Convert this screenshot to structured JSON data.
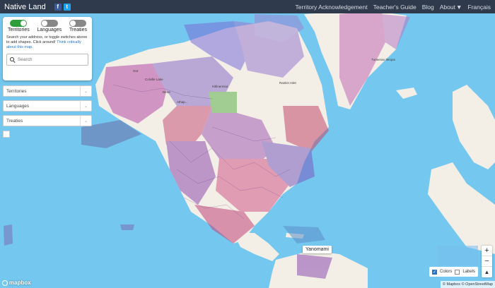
{
  "navbar": {
    "brand": "Native Land",
    "facebook_icon": "f",
    "twitter_icon": "t",
    "links": [
      "Territory Acknowledgement",
      "Teacher's Guide",
      "Blog",
      "About",
      "Français"
    ]
  },
  "panel": {
    "toggles": [
      {
        "label": "Territories",
        "on": true
      },
      {
        "label": "Languages",
        "on": false
      },
      {
        "label": "Treaties",
        "on": false
      }
    ],
    "help_text": "Search your address, or toggle switches above to add shapes. Click around!",
    "help_link": "Think critically about this map.",
    "search_placeholder": "Search"
  },
  "selects": [
    "Territories",
    "Languages",
    "Treaties"
  ],
  "tooltip": "Yanomami",
  "map_labels": [
    "Tuneeran Ilerqan",
    "Rankin Inlet",
    "Colville Lake",
    "Dene",
    "Kitlinermiut",
    "Oot",
    "Athap..."
  ],
  "zoom": {
    "plus": "+",
    "minus": "−",
    "compass": "▲"
  },
  "layer_toggle": {
    "colors_label": "Colors",
    "labels_label": "Labels",
    "colors_checked": true,
    "labels_checked": false
  },
  "attribution": "© Mapbox © OpenStreetMap",
  "logo": "mapbox",
  "colors": {
    "navbar": "#2f3b4c",
    "ocean": "#74c7ee",
    "land": "#f3efe6",
    "toggle_on": "#2e9e3a"
  }
}
